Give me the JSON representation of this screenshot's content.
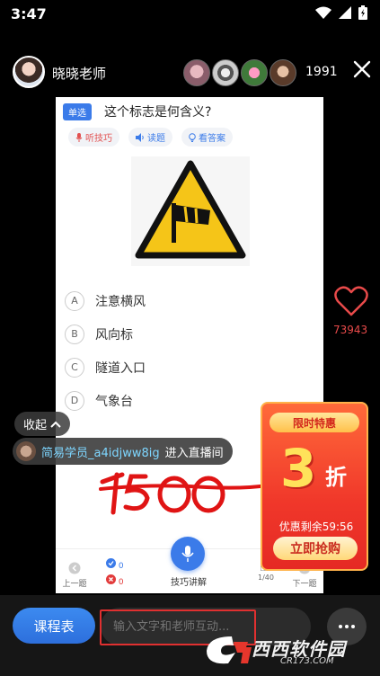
{
  "status": {
    "time": "3:47"
  },
  "host": {
    "name": "晓晓老师",
    "viewer_count": "1991"
  },
  "question": {
    "type": "单选",
    "text": "这个标志是何含义?",
    "tools": [
      {
        "label": "听技巧",
        "icon": "mic-icon",
        "color": "#e25050"
      },
      {
        "label": "读题",
        "icon": "speaker-icon",
        "color": "#3b7be9"
      },
      {
        "label": "看答案",
        "icon": "bulb-icon",
        "color": "#3b7be9"
      }
    ],
    "options": [
      {
        "letter": "A",
        "text": "注意横风"
      },
      {
        "letter": "B",
        "text": "风向标"
      },
      {
        "letter": "C",
        "text": "隧道入口"
      },
      {
        "letter": "D",
        "text": "气象台"
      }
    ],
    "bottom": {
      "prev": "上一题",
      "correct_count": "0",
      "wrong_count": "0",
      "skill": "技巧讲解",
      "progress": "1/40",
      "next": "下一题"
    }
  },
  "likes": {
    "count": "73943"
  },
  "chat": {
    "collapse": "收起",
    "join_user": "简易学员_a4idjww8ig",
    "join_text": "进入直播间"
  },
  "handwriting": "1500",
  "promo": {
    "badge": "限时特惠",
    "discount_number": "3",
    "discount_unit": "折",
    "remaining": "优惠剩余59:56",
    "button": "立即抢购"
  },
  "bottom_bar": {
    "course_button": "课程表",
    "input_placeholder": "输入文字和老师互动..."
  },
  "watermark": {
    "text": "西西软件园",
    "sub": "CR173.COM"
  },
  "colors": {
    "accent_blue": "#3b7be9",
    "like_red": "#e84a4a",
    "promo_red": "#f0372a"
  }
}
